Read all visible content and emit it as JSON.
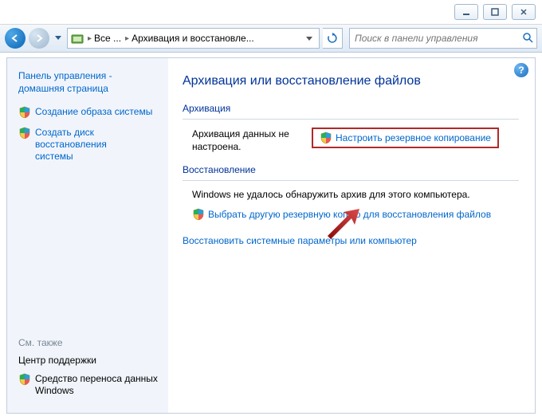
{
  "titlebar": {
    "min_tip": "Свернуть",
    "max_tip": "Развернуть",
    "close_tip": "Закрыть"
  },
  "breadcrumb": {
    "seg1": "Все ...",
    "seg2": "Архивация и восстановле..."
  },
  "search": {
    "placeholder": "Поиск в панели управления"
  },
  "sidebar": {
    "home1": "Панель управления -",
    "home2": "домашняя страница",
    "item1": "Создание образа системы",
    "item2_l1": "Создать диск восстановления",
    "item2_l2": "системы",
    "see_also": "См. также",
    "sa1": "Центр поддержки",
    "sa2_l1": "Средство переноса данных",
    "sa2_l2": "Windows"
  },
  "main": {
    "title": "Архивация или восстановление файлов",
    "group_backup": "Архивация",
    "backup_status_l1": "Архивация данных не",
    "backup_status_l2": "настроена.",
    "setup_backup": "Настроить резервное копирование",
    "group_restore": "Восстановление",
    "restore_status": "Windows не удалось обнаружить архив для этого компьютера.",
    "choose_other": "Выбрать другую резервную копию для восстановления файлов",
    "restore_sys": "Восстановить системные параметры или компьютер"
  }
}
